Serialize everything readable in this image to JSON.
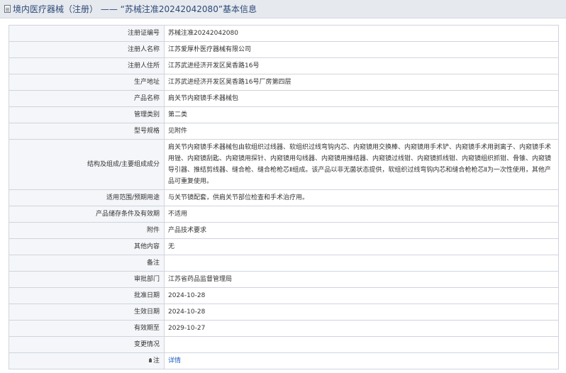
{
  "header": {
    "title": "境内医疗器械（注册） —— “苏械注准20242042080”基本信息"
  },
  "rows": [
    {
      "label": "注册证编号",
      "value": "苏械注准20242042080"
    },
    {
      "label": "注册人名称",
      "value": "江苏爱厚朴医疗器械有限公司"
    },
    {
      "label": "注册人住所",
      "value": "江苏武进经济开发区昊香路16号"
    },
    {
      "label": "生产地址",
      "value": "江苏武进经济开发区昊香路16号厂房第四层"
    },
    {
      "label": "产品名称",
      "value": "肩关节内窥镜手术器械包"
    },
    {
      "label": "管理类别",
      "value": "第二类"
    },
    {
      "label": "型号规格",
      "value": "见附件"
    },
    {
      "label": "结构及组成/主要组成成分",
      "value": "肩关节内窥镜手术器械包由软组织过线器、软组织过线弯钩内芯、内窥镜用交换棒、内窥镜用手术铲、内窥镜手术用剥离子、内窥镜手术用锉、内窥镜刮匙、内窥镜用探针、内窥镜用勾线器、内窥镜用推结器、内窥镜过线钳、内窥镜抓线钳、内窥镜组织抓钳、骨锥、内窥镜导引器、推结剪线器、缝合枪、缝合枪枪芯Ⅱ组成。该产品以非无菌状态提供，软组织过线弯钩内芯和缝合枪枪芯Ⅱ为一次性使用，其他产品可重复使用。"
    },
    {
      "label": "适用范围/预期用途",
      "value": "与关节镜配套，供肩关节部位检查和手术治疗用。"
    },
    {
      "label": "产品储存条件及有效期",
      "value": "不适用"
    },
    {
      "label": "附件",
      "value": "产品技术要求"
    },
    {
      "label": "其他内容",
      "value": "无"
    },
    {
      "label": "备注",
      "value": ""
    },
    {
      "label": "审批部门",
      "value": "江苏省药品监督管理局"
    },
    {
      "label": "批准日期",
      "value": "2024-10-28"
    },
    {
      "label": "生效日期",
      "value": "2024-10-28"
    },
    {
      "label": "有效期至",
      "value": "2029-10-27"
    },
    {
      "label": "变更情况",
      "value": ""
    }
  ],
  "note_row": {
    "label": "注",
    "link_text": "详情"
  },
  "colors": {
    "header_bg": "#e6e9ee",
    "header_text": "#2d4a78",
    "label_bg": "#f4f6f9",
    "border": "#cfd5dd",
    "link": "#1f5fbf"
  }
}
